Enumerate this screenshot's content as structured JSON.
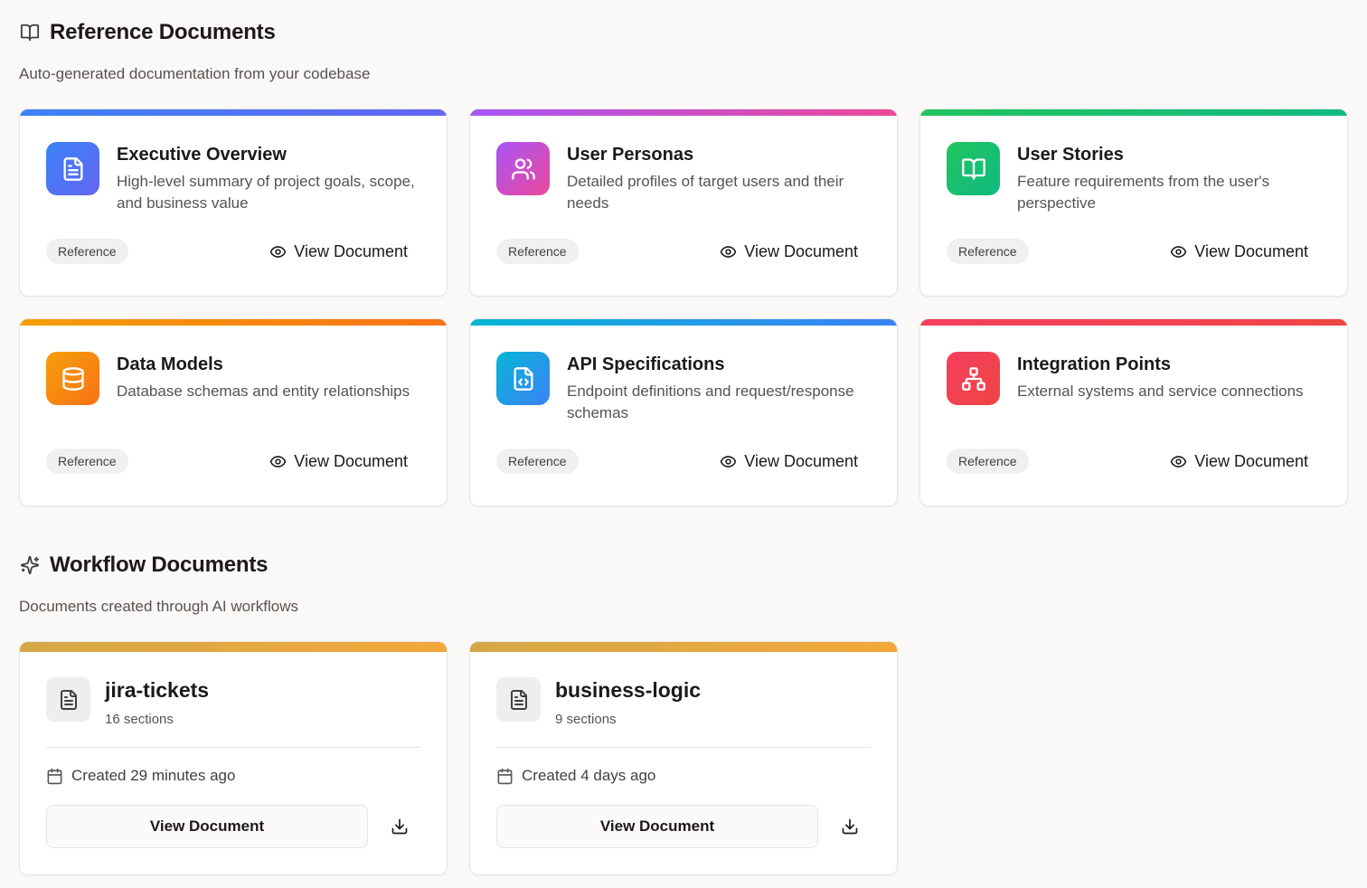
{
  "reference": {
    "title": "Reference Documents",
    "subtitle": "Auto-generated documentation from your codebase",
    "cards": [
      {
        "title": "Executive Overview",
        "desc": "High-level summary of project goals, scope, and business value",
        "badge": "Reference",
        "action": "View Document",
        "icon": "file-text-icon",
        "gradient": [
          "#3b82f6",
          "#6366f1"
        ]
      },
      {
        "title": "User Personas",
        "desc": "Detailed profiles of target users and their needs",
        "badge": "Reference",
        "action": "View Document",
        "icon": "users-icon",
        "gradient": [
          "#a855f7",
          "#ec4899"
        ]
      },
      {
        "title": "User Stories",
        "desc": "Feature requirements from the user's perspective",
        "badge": "Reference",
        "action": "View Document",
        "icon": "book-open-icon",
        "gradient": [
          "#22c55e",
          "#10b981"
        ]
      },
      {
        "title": "Data Models",
        "desc": "Database schemas and entity relationships",
        "badge": "Reference",
        "action": "View Document",
        "icon": "database-icon",
        "gradient": [
          "#f59e0b",
          "#f97316"
        ]
      },
      {
        "title": "API Specifications",
        "desc": "Endpoint definitions and request/response schemas",
        "badge": "Reference",
        "action": "View Document",
        "icon": "file-code-icon",
        "gradient": [
          "#06b6d4",
          "#3b82f6"
        ]
      },
      {
        "title": "Integration Points",
        "desc": "External systems and service connections",
        "badge": "Reference",
        "action": "View Document",
        "icon": "network-icon",
        "gradient": [
          "#f43f5e",
          "#ef4444"
        ]
      }
    ]
  },
  "workflow": {
    "title": "Workflow Documents",
    "subtitle": "Documents created through AI workflows",
    "cards": [
      {
        "title": "jira-tickets",
        "sections": "16 sections",
        "created": "Created 29 minutes ago",
        "action": "View Document"
      },
      {
        "title": "business-logic",
        "sections": "9 sections",
        "created": "Created 4 days ago",
        "action": "View Document"
      }
    ]
  }
}
